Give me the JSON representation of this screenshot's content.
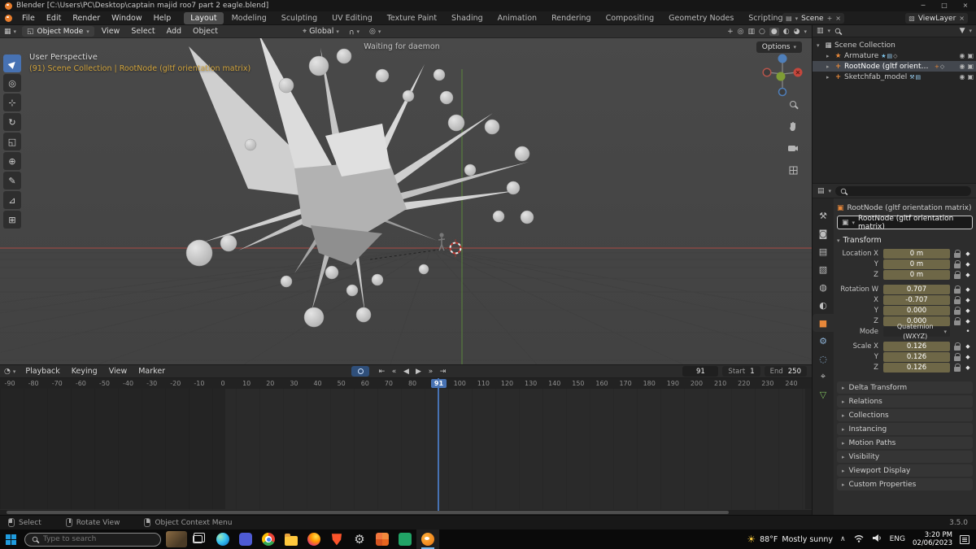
{
  "titlebar": {
    "title": "Blender [C:\\Users\\PC\\Desktop\\captain majid roo7 part 2 eagle.blend]"
  },
  "menubar": {
    "menus": [
      "File",
      "Edit",
      "Render",
      "Window",
      "Help"
    ],
    "workspaces": [
      "Layout",
      "Modeling",
      "Sculpting",
      "UV Editing",
      "Texture Paint",
      "Shading",
      "Animation",
      "Rendering",
      "Compositing",
      "Geometry Nodes",
      "Scripting",
      "+"
    ],
    "active_workspace": "Layout",
    "scene_label": "Scene",
    "viewlayer_label": "ViewLayer"
  },
  "viewport_header": {
    "mode": "Object Mode",
    "menus": [
      "View",
      "Select",
      "Add",
      "Object"
    ],
    "orientation": "Global",
    "options_label": "Options"
  },
  "viewport": {
    "perspective_label": "User Perspective",
    "context_label": "(91) Scene Collection | RootNode (gltf orientation matrix)",
    "center_message": "Waiting for daemon",
    "tools": [
      "tweak",
      "cursor",
      "move",
      "rotate",
      "scale",
      "transform",
      "annotate",
      "measure",
      "add-cube"
    ]
  },
  "outliner": {
    "rows": [
      {
        "label": "Scene Collection",
        "icon": "collection-icon",
        "expanded": true,
        "indent": 0,
        "selected": false,
        "badges": [],
        "toggles": false
      },
      {
        "label": "Armature",
        "icon": "armature-icon",
        "expanded": false,
        "indent": 1,
        "selected": false,
        "badges": [
          "pose",
          "data",
          "action"
        ],
        "toggles": true
      },
      {
        "label": "RootNode (gltf orientation matrix)",
        "icon": "empty-axes-icon",
        "expanded": false,
        "indent": 1,
        "selected": true,
        "badges": [
          "axes",
          "action"
        ],
        "toggles": true
      },
      {
        "label": "Sketchfab_model",
        "icon": "empty-axes-icon",
        "expanded": false,
        "indent": 1,
        "selected": false,
        "badges": [
          "wrench",
          "data"
        ],
        "toggles": true
      }
    ]
  },
  "properties": {
    "breadcrumb": "RootNode (gltf orientation matrix)",
    "object_name": "RootNode (gltf orientation matrix)",
    "transform_title": "Transform",
    "transform_rows": [
      {
        "label": "Location X",
        "value": "0 m"
      },
      {
        "label": "Y",
        "value": "0 m"
      },
      {
        "label": "Z",
        "value": "0 m"
      },
      {
        "label": "Rotation W",
        "value": "0.707",
        "gap": true
      },
      {
        "label": "X",
        "value": "-0.707"
      },
      {
        "label": "Y",
        "value": "0.000"
      },
      {
        "label": "Z",
        "value": "0.000"
      },
      {
        "label": "Mode",
        "value": "Quaternion (WXYZ)",
        "dropdown": true
      },
      {
        "label": "Scale X",
        "value": "0.126",
        "gap": true
      },
      {
        "label": "Y",
        "value": "0.126"
      },
      {
        "label": "Z",
        "value": "0.126"
      }
    ],
    "sections": [
      "Delta Transform",
      "Relations",
      "Collections",
      "Instancing",
      "Motion Paths",
      "Visibility",
      "Viewport Display",
      "Custom Properties"
    ],
    "tabs": [
      "tool",
      "render",
      "output",
      "view-layer",
      "scene",
      "world",
      "object",
      "modifiers",
      "physics",
      "constraints",
      "data"
    ],
    "active_tab": "object"
  },
  "timeline": {
    "menus": [
      "Playback",
      "Keying",
      "View",
      "Marker"
    ],
    "transport": [
      "jump-to-start",
      "jump-to-previous-keyframe",
      "play-reverse",
      "play",
      "jump-to-next-keyframe",
      "jump-to-end"
    ],
    "current_frame": "91",
    "start_label": "Start",
    "start_value": "1",
    "end_label": "End",
    "end_value": "250",
    "ticks": [
      -90,
      -80,
      -70,
      -60,
      -50,
      -40,
      -30,
      -20,
      -10,
      0,
      10,
      20,
      30,
      40,
      50,
      60,
      70,
      80,
      100,
      110,
      120,
      130,
      140,
      150,
      160,
      170,
      180,
      190,
      200,
      210,
      220,
      230,
      240
    ]
  },
  "statusbar": {
    "hints": [
      {
        "button": "LMB",
        "label": "Select"
      },
      {
        "button": "MMB",
        "label": "Rotate View"
      },
      {
        "button": "RMB",
        "label": "Object Context Menu"
      }
    ],
    "version": "3.5.0"
  },
  "taskbar": {
    "search_placeholder": "Type to search",
    "apps": [
      "edge",
      "teams",
      "chrome",
      "file-explorer",
      "firefox",
      "brave",
      "settings",
      "photos",
      "office-green",
      "blender"
    ],
    "active_app": "blender",
    "weather_temp": "88°F",
    "weather_desc": "Mostly sunny",
    "language": "ENG",
    "time": "3:20 PM",
    "date": "02/06/2023"
  },
  "colors": {
    "accent_blue": "#4772b3",
    "keyframe_field": "#6e6747",
    "blender_orange": "#e8883a"
  }
}
